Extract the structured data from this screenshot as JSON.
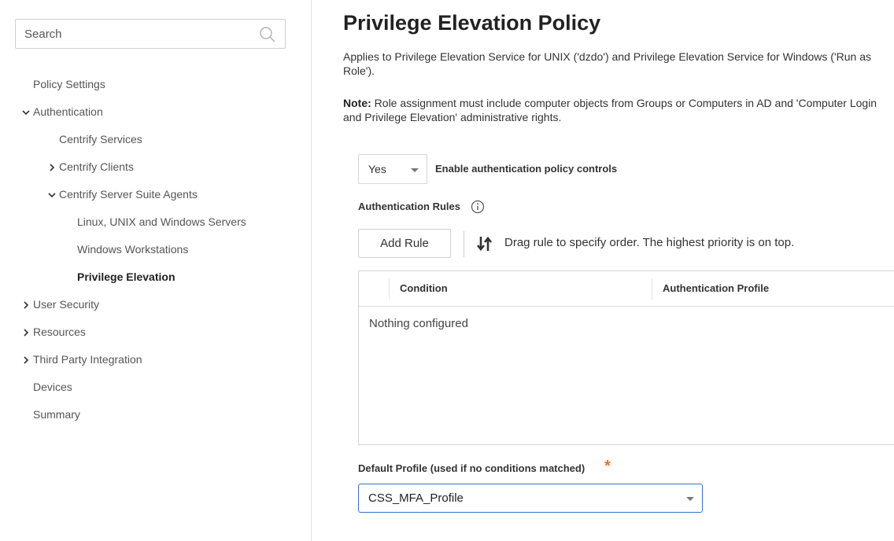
{
  "sidebar": {
    "search": {
      "placeholder": "Search"
    },
    "items": [
      {
        "label": "Policy Settings"
      },
      {
        "label": "Authentication",
        "chevron": "expanded"
      },
      {
        "label": "Centrify Services"
      },
      {
        "label": "Centrify Clients",
        "chevron": "collapsed"
      },
      {
        "label": "Centrify Server Suite Agents",
        "chevron": "expanded"
      },
      {
        "label": "Linux, UNIX and Windows Servers"
      },
      {
        "label": "Windows Workstations"
      },
      {
        "label": "Privilege Elevation",
        "active": true
      },
      {
        "label": "User Security",
        "chevron": "collapsed"
      },
      {
        "label": "Resources",
        "chevron": "collapsed"
      },
      {
        "label": "Third Party Integration",
        "chevron": "collapsed"
      },
      {
        "label": "Devices"
      },
      {
        "label": "Summary"
      }
    ]
  },
  "main": {
    "title": "Privilege Elevation Policy",
    "description": "Applies to Privilege Elevation Service for UNIX ('dzdo') and Privilege Elevation Service for Windows ('Run as Role').",
    "note_label": "Note:",
    "note_text": " Role assignment must include computer objects from Groups or Computers in AD and 'Computer Login and Privilege Elevation' administrative rights.",
    "enable_select_value": "Yes",
    "enable_label": "Enable authentication policy controls",
    "rules_label": "Authentication Rules",
    "add_rule_label": "Add Rule",
    "drag_hint": "Drag rule to specify order. The highest priority is on top.",
    "table": {
      "columns": [
        "Condition",
        "Authentication Profile"
      ],
      "empty_message": "Nothing configured"
    },
    "default_profile_label": "Default Profile (used if no conditions matched)",
    "required_marker": "*",
    "default_profile_value": "CSS_MFA_Profile"
  },
  "colors": {
    "focus_border": "#2f74c9",
    "required": "#f07020"
  }
}
